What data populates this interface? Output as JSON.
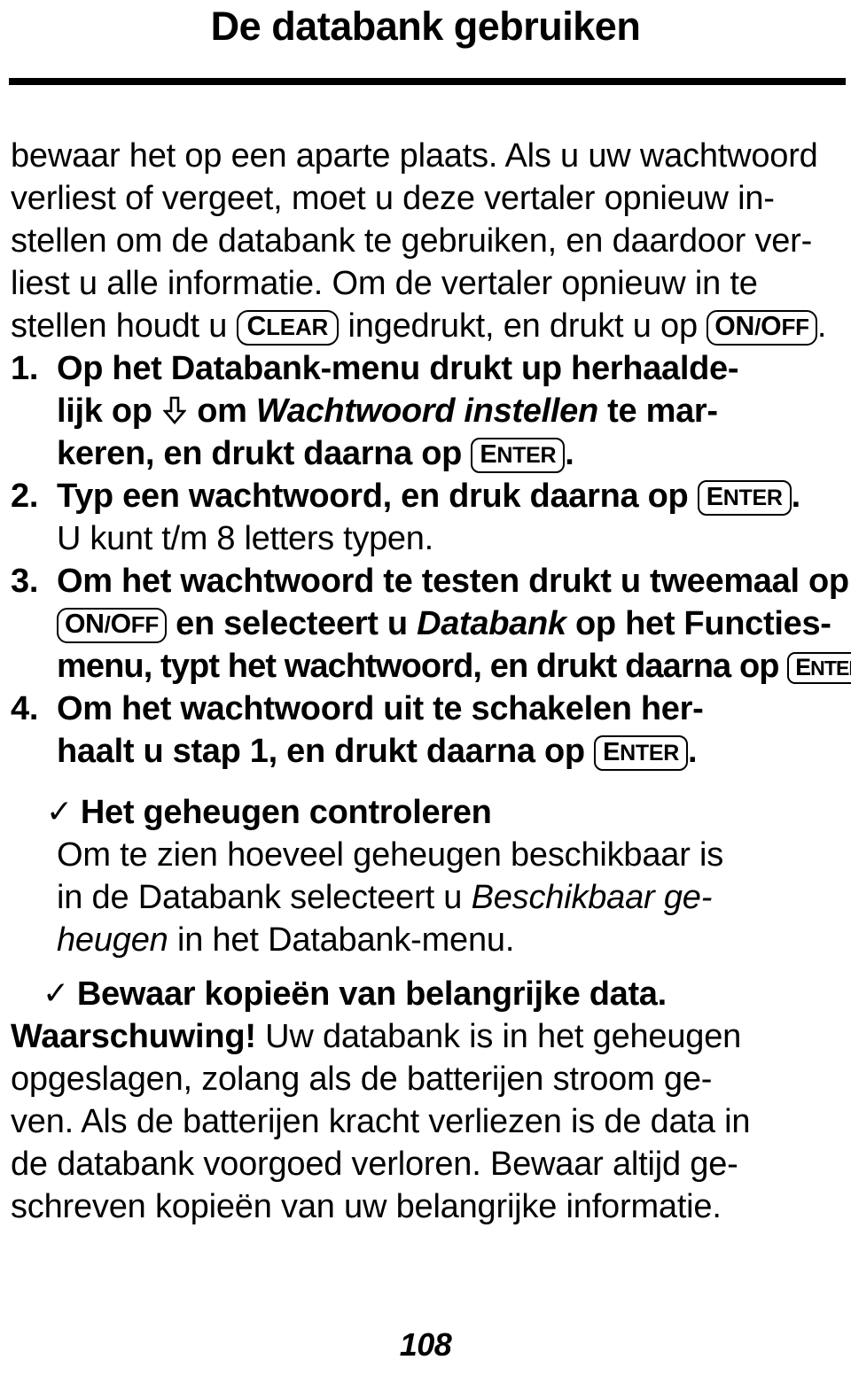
{
  "document": {
    "title": "De databank gebruiken",
    "page_number": "108"
  },
  "intro_paragraph": {
    "lines": [
      "bewaar het op een aparte plaats. Als u uw wachtwoord",
      "verliest of vergeet, moet u deze vertaler opnieuw in-",
      "stellen om de databank te gebruiken, en daardoor ver-",
      "liest u alle informatie. Om de vertaler opnieuw in te"
    ],
    "last_line": {
      "before_key": "stellen houdt u ",
      "key1": "CLEAR",
      "middle": " ingedrukt, en drukt u op ",
      "key2": "ON/OFF",
      "after": "."
    }
  },
  "steps": [
    {
      "number": "1.",
      "line1": "Op het Databank-menu drukt up herhaalde-",
      "line2_a": "lijk op ",
      "line2_icon": "down-arrow-icon",
      "line2_b": " om ",
      "line2_italic": "Wachtwoord instellen",
      "line2_c": " te mar-",
      "line3_a": "keren, en drukt daarna op ",
      "line3_key": "ENTER",
      "line3_b": "."
    },
    {
      "number": "2.",
      "line1_a": "Typ een wachtwoord, en druk daarna op ",
      "line1_key": "ENTER",
      "line1_b": ".",
      "line2_plain": "U kunt t/m 8 letters typen."
    },
    {
      "number": "3.",
      "line1": "Om het wachtwoord te testen drukt u tweemaal op",
      "line2_key": "ON/OFF",
      "line2_a": " en selecteert u ",
      "line2_italic": "Databank",
      "line2_b": " op het Functies-",
      "line3_a": "menu, typt het wachtwoord, en drukt daarna op ",
      "line3_key": "ENTER",
      "line3_b": "."
    },
    {
      "number": "4.",
      "line1": "Om het wachtwoord uit te schakelen her-",
      "line2_a": "haalt u stap 1, en drukt daarna op ",
      "line2_key": "ENTER",
      "line2_b": "."
    }
  ],
  "section_memory": {
    "check_icon": "check-icon",
    "heading": "Het geheugen controleren",
    "body_line1": "Om te zien hoeveel geheugen beschikbaar is",
    "body_line2_a": "in de Databank selecteert u ",
    "body_line2_italic": "Beschikbaar ge-",
    "body_line3_italic": "heugen",
    "body_line3_b": " in het Databank-menu."
  },
  "section_backup": {
    "check_icon": "check-icon",
    "heading": "Bewaar kopieën van belangrijke data.",
    "warning_label": "Waarschuwing!",
    "warning_line1_rest": " Uw databank is in het geheugen",
    "warning_line2": "opgeslagen, zolang als de batterijen stroom ge-",
    "warning_line3": "ven. Als de batterijen kracht verliezen is de data in",
    "warning_line4": "de databank voorgoed verloren. Bewaar altijd ge-",
    "warning_line5": "schreven kopieën van uw belangrijke informatie."
  }
}
